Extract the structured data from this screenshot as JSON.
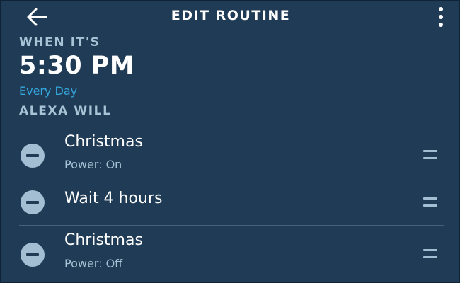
{
  "header": {
    "back_icon": "arrow-left-icon",
    "title": "EDIT ROUTINE",
    "menu_icon": "more-vertical-icon"
  },
  "trigger": {
    "label": "WHEN IT'S",
    "time": "5:30 PM",
    "recurrence": "Every Day"
  },
  "actions_section": {
    "label": "ALEXA WILL",
    "items": [
      {
        "title": "Christmas",
        "subtitle": "Power: On"
      },
      {
        "title": "Wait 4 hours",
        "subtitle": ""
      },
      {
        "title": "Christmas",
        "subtitle": "Power: Off"
      }
    ]
  },
  "colors": {
    "background": "#1f3b55",
    "accent": "#35a6dc",
    "muted_text": "#a8c3d6",
    "divider": "#45627a"
  }
}
